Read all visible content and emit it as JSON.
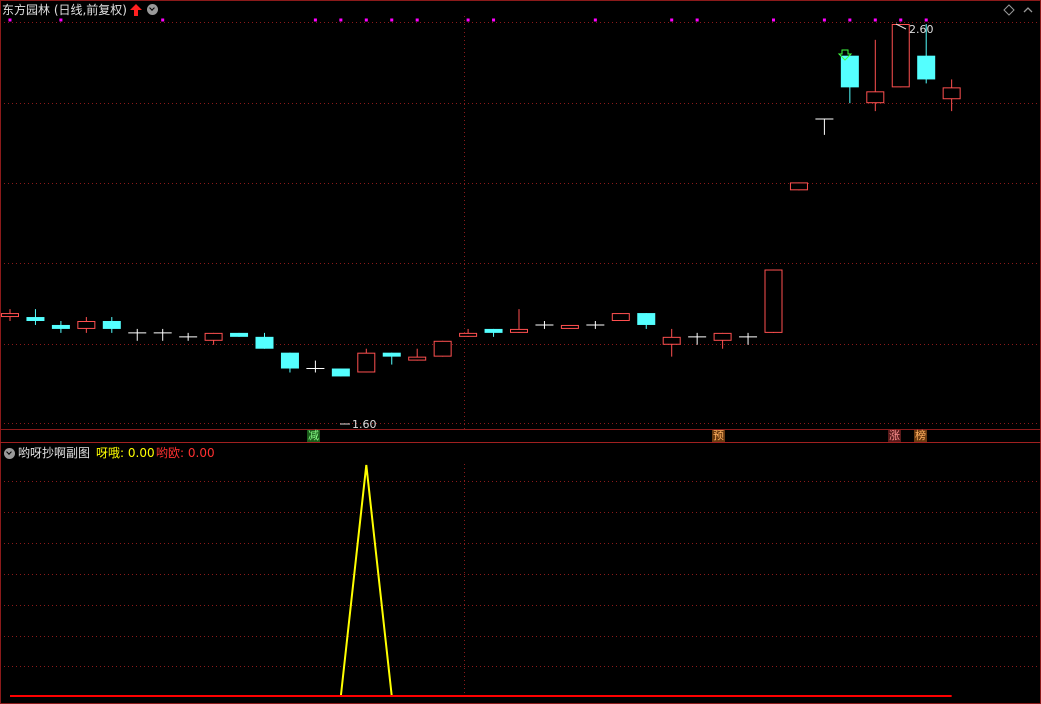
{
  "main_chart": {
    "title": "东方园林 (日线,前复权)",
    "high_label": "2.60",
    "low_label": "1.60",
    "markers": [
      "减",
      "预",
      "涨",
      "榜"
    ]
  },
  "sub_chart": {
    "title": "哟呀抄啊副图",
    "series": [
      {
        "name": "呀哦",
        "value": "0.00"
      },
      {
        "name": "哟欧",
        "value": "0.00"
      }
    ]
  },
  "colors": {
    "up": "#ff5050",
    "down": "#54ffff",
    "grid": "#8b1a1a",
    "yellow": "#ffff00",
    "red": "#ff0000",
    "dots": "#ff00ff"
  },
  "chart_data": {
    "type": "candlestick",
    "note_values": "price units estimated from labeled high 2.60 and low 1.60",
    "candles": [
      {
        "o": 1.86,
        "h": 1.88,
        "l": 1.85,
        "c": 1.87
      },
      {
        "o": 1.86,
        "h": 1.88,
        "l": 1.84,
        "c": 1.85
      },
      {
        "o": 1.84,
        "h": 1.85,
        "l": 1.82,
        "c": 1.83
      },
      {
        "o": 1.83,
        "h": 1.86,
        "l": 1.82,
        "c": 1.85
      },
      {
        "o": 1.85,
        "h": 1.86,
        "l": 1.82,
        "c": 1.83
      },
      {
        "o": 1.82,
        "h": 1.83,
        "l": 1.8,
        "c": 1.82
      },
      {
        "o": 1.82,
        "h": 1.83,
        "l": 1.8,
        "c": 1.82
      },
      {
        "o": 1.81,
        "h": 1.82,
        "l": 1.8,
        "c": 1.81
      },
      {
        "o": 1.8,
        "h": 1.82,
        "l": 1.79,
        "c": 1.82
      },
      {
        "o": 1.82,
        "h": 1.82,
        "l": 1.81,
        "c": 1.81
      },
      {
        "o": 1.81,
        "h": 1.82,
        "l": 1.78,
        "c": 1.78
      },
      {
        "o": 1.77,
        "h": 1.77,
        "l": 1.72,
        "c": 1.73
      },
      {
        "o": 1.73,
        "h": 1.75,
        "l": 1.72,
        "c": 1.73
      },
      {
        "o": 1.73,
        "h": 1.73,
        "l": 1.71,
        "c": 1.71
      },
      {
        "o": 1.72,
        "h": 1.78,
        "l": 1.72,
        "c": 1.77
      },
      {
        "o": 1.77,
        "h": 1.77,
        "l": 1.74,
        "c": 1.76
      },
      {
        "o": 1.75,
        "h": 1.78,
        "l": 1.75,
        "c": 1.76
      },
      {
        "o": 1.76,
        "h": 1.8,
        "l": 1.76,
        "c": 1.8
      },
      {
        "o": 1.81,
        "h": 1.83,
        "l": 1.81,
        "c": 1.82
      },
      {
        "o": 1.83,
        "h": 1.83,
        "l": 1.81,
        "c": 1.82
      },
      {
        "o": 1.82,
        "h": 1.88,
        "l": 1.82,
        "c": 1.83
      },
      {
        "o": 1.84,
        "h": 1.85,
        "l": 1.83,
        "c": 1.84
      },
      {
        "o": 1.83,
        "h": 1.84,
        "l": 1.83,
        "c": 1.84
      },
      {
        "o": 1.84,
        "h": 1.85,
        "l": 1.83,
        "c": 1.84
      },
      {
        "o": 1.85,
        "h": 1.87,
        "l": 1.85,
        "c": 1.87
      },
      {
        "o": 1.87,
        "h": 1.87,
        "l": 1.83,
        "c": 1.84
      },
      {
        "o": 1.79,
        "h": 1.83,
        "l": 1.76,
        "c": 1.81
      },
      {
        "o": 1.81,
        "h": 1.82,
        "l": 1.79,
        "c": 1.81
      },
      {
        "o": 1.8,
        "h": 1.82,
        "l": 1.78,
        "c": 1.82
      },
      {
        "o": 1.81,
        "h": 1.82,
        "l": 1.79,
        "c": 1.81
      },
      {
        "o": 1.82,
        "h": 1.98,
        "l": 1.82,
        "c": 1.98
      },
      {
        "o": 2.18,
        "h": 2.2,
        "l": 2.18,
        "c": 2.2
      },
      {
        "o": 2.36,
        "h": 2.36,
        "l": 2.32,
        "c": 2.36
      },
      {
        "o": 2.52,
        "h": 2.52,
        "l": 2.4,
        "c": 2.44
      },
      {
        "o": 2.4,
        "h": 2.56,
        "l": 2.38,
        "c": 2.43
      },
      {
        "o": 2.44,
        "h": 2.6,
        "l": 2.44,
        "c": 2.6
      },
      {
        "o": 2.52,
        "h": 2.6,
        "l": 2.45,
        "c": 2.46
      },
      {
        "o": 2.41,
        "h": 2.46,
        "l": 2.38,
        "c": 2.44
      }
    ],
    "sub_series": {
      "name": "呀哦",
      "x": [
        13,
        14,
        15
      ],
      "values": [
        0,
        1,
        0
      ]
    },
    "baseline_series": {
      "name": "哟欧",
      "value": 0
    }
  }
}
